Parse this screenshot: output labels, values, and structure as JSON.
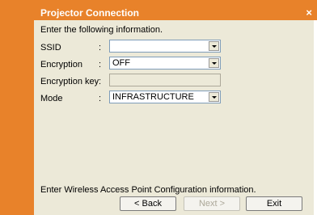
{
  "window": {
    "title": "Projector Connection",
    "close_symbol": "×"
  },
  "form": {
    "instruction": "Enter the following information.",
    "colon": ":",
    "fields": [
      {
        "label": "SSID",
        "value": ""
      },
      {
        "label": "Encryption",
        "value": "OFF"
      },
      {
        "label": "Encryption key",
        "value": ""
      },
      {
        "label": "Mode",
        "value": "INFRASTRUCTURE"
      }
    ],
    "footer_text": "Enter Wireless Access Point Configuration information."
  },
  "buttons": {
    "back": "< Back",
    "next": "Next >",
    "exit": "Exit"
  },
  "colors": {
    "accent": "#e8822a",
    "dialog_bg": "#ece9d8"
  }
}
